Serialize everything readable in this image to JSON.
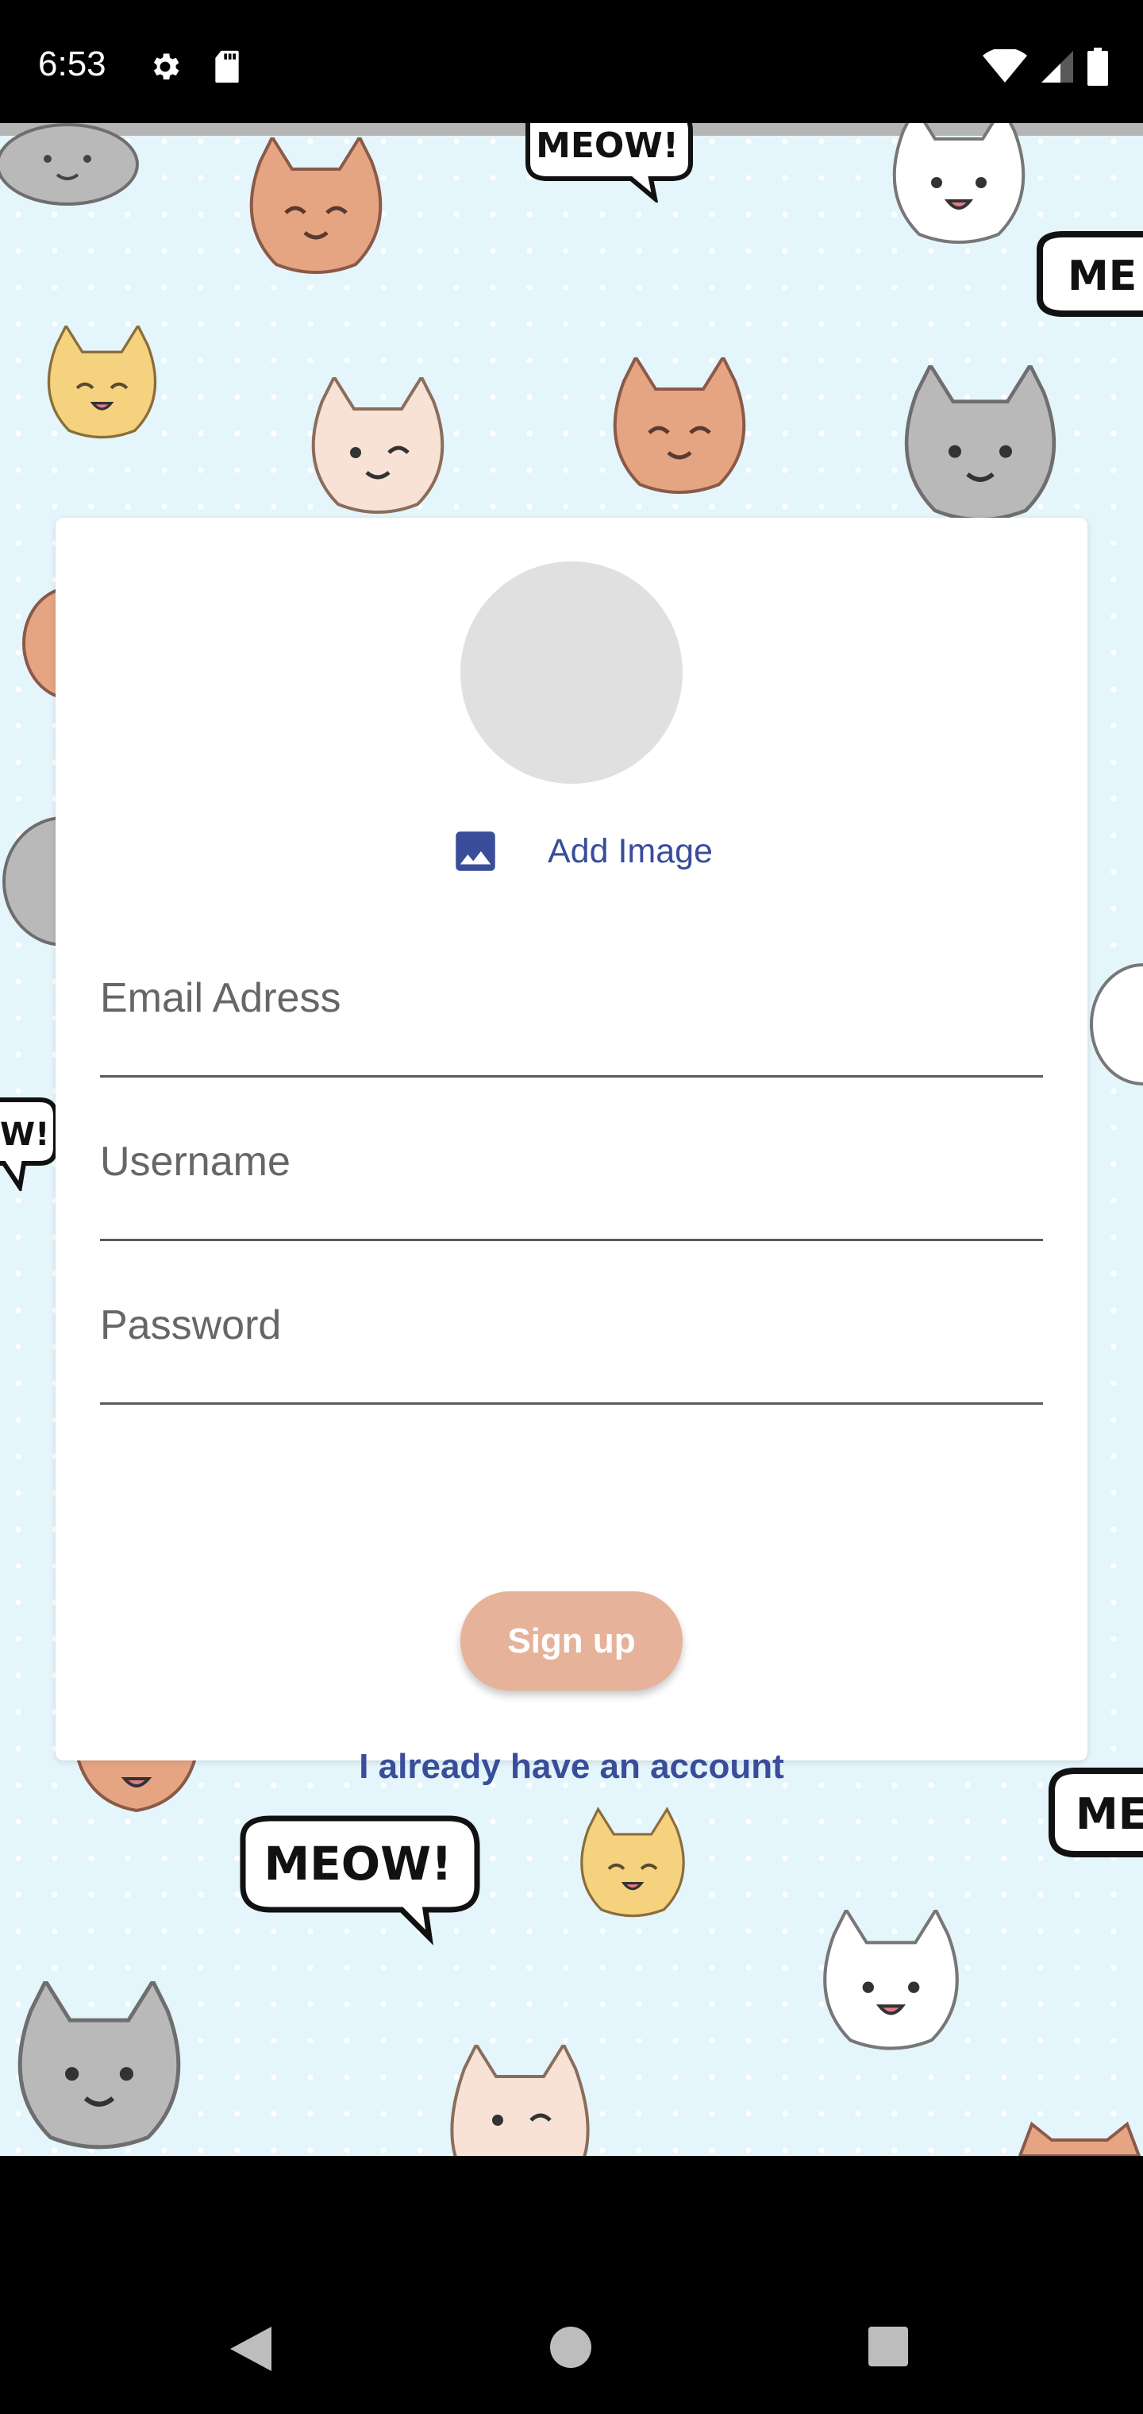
{
  "status_bar": {
    "time": "6:53",
    "icons": [
      "settings-gear-icon",
      "sd-card-icon",
      "wifi-icon",
      "cell-signal-icon",
      "battery-icon"
    ]
  },
  "background": {
    "speech_bubble_text": "MEOW!",
    "partial_bubble_text_right": "ME",
    "partial_bubble_text_left": "W!"
  },
  "signup_card": {
    "avatar_icon": "avatar-placeholder",
    "add_image": {
      "icon": "image-icon",
      "label": "Add Image"
    },
    "fields": {
      "email": {
        "label": "Email Adress"
      },
      "username": {
        "label": "Username"
      },
      "password": {
        "label": "Password"
      }
    },
    "signup_button": {
      "label": "Sign up"
    },
    "login_link": {
      "label": "I already have an account"
    }
  },
  "nav_bar": {
    "icons": [
      "back-icon",
      "home-icon",
      "recent-apps-icon"
    ]
  },
  "colors": {
    "accent": "#3a4d9a",
    "button": "#e6b29a",
    "background": "#e4f5fb"
  }
}
